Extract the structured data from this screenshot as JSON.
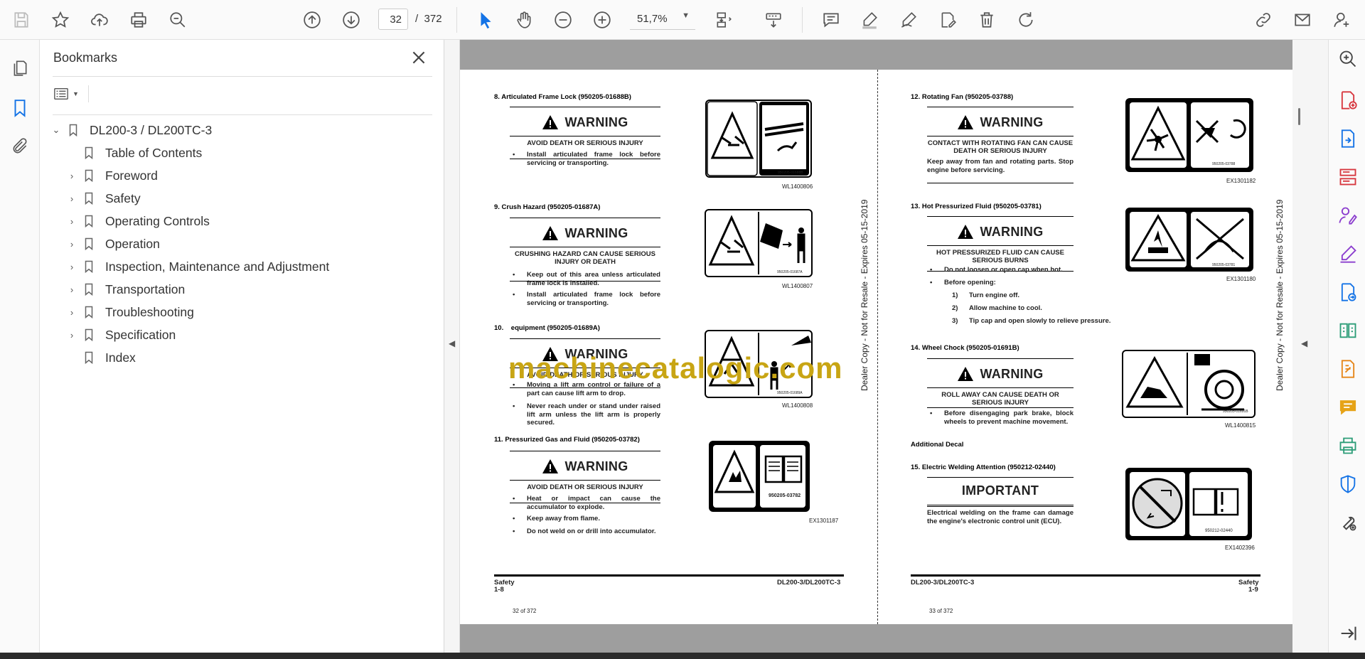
{
  "toolbar": {
    "page_current": "32",
    "page_total": "372",
    "page_sep": "/",
    "zoom": "51,7%"
  },
  "bookmarks": {
    "title": "Bookmarks",
    "items": [
      {
        "label": "DL200-3 / DL200TC-3",
        "level": 0,
        "expanded": true
      },
      {
        "label": "Table of Contents",
        "level": 1
      },
      {
        "label": "Foreword",
        "level": 1,
        "expandable": true
      },
      {
        "label": "Safety",
        "level": 1,
        "expandable": true
      },
      {
        "label": "Operating Controls",
        "level": 1,
        "expandable": true
      },
      {
        "label": "Operation",
        "level": 1,
        "expandable": true
      },
      {
        "label": "Inspection, Maintenance and Adjustment",
        "level": 1,
        "expandable": true
      },
      {
        "label": "Transportation",
        "level": 1,
        "expandable": true
      },
      {
        "label": "Troubleshooting",
        "level": 1,
        "expandable": true
      },
      {
        "label": "Specification",
        "level": 1,
        "expandable": true
      },
      {
        "label": "Index",
        "level": 1
      }
    ]
  },
  "doc": {
    "watermark": "machinecatalogic.com",
    "dealer_note": "Dealer Copy - Not for Resale - Expires 05-15-2019",
    "warning": "WARNING",
    "important": "IMPORTANT",
    "left": {
      "s8": {
        "title": "8.    Articulated Frame Lock (950205-01688B)",
        "avoid": "AVOID DEATH OR SERIOUS INJURY",
        "b1": "Install articulated frame lock before servicing or transporting.",
        "decal": "950205-01688B",
        "ref": "WL1400806"
      },
      "s9": {
        "title": "9.    Crush Hazard (950205-01687A)",
        "avoid": "CRUSHING HAZARD CAN CAUSE SERIOUS INJURY OR DEATH",
        "b1": "Keep out of this area unless articulated frame lock is installed.",
        "b2": "Install articulated frame lock before servicing or transporting.",
        "decal": "950205-01687A",
        "ref": "WL1400807"
      },
      "s10": {
        "title": "10.",
        "title_partial": "equipment (950205-01689A)",
        "avoid": "AVOID DEATH OR SERIOUS INJURY",
        "b1": "Moving a lift arm control or failure of a part can cause lift arm to drop.",
        "b2": "Never reach under or stand under raised lift arm unless the lift arm is properly secured.",
        "decal": "950205-01689A",
        "ref": "WL1400808"
      },
      "s11": {
        "title": "11.    Pressurized Gas and Fluid (950205-03782)",
        "avoid": "AVOID DEATH OR SERIOUS INJURY",
        "b1": "Heat or impact can cause the accumulator to explode.",
        "b2": "Keep away from flame.",
        "b3": "Do not weld on or drill into accumulator.",
        "decal": "950205-03782",
        "ref": "EX1301187"
      },
      "footer_left": "Safety",
      "footer_left2": "1-8",
      "footer_right": "DL200-3/DL200TC-3",
      "pagenum": "32 of 372"
    },
    "right": {
      "s12": {
        "title": "12.    Rotating Fan (950205-03788)",
        "avoid": "CONTACT WITH ROTATING FAN CAN CAUSE DEATH OR SERIOUS INJURY",
        "body": "Keep away from fan and rotating parts. Stop engine before servicing.",
        "decal": "950205-03788",
        "ref": "EX1301182"
      },
      "s13": {
        "title": "13.    Hot Pressurized Fluid (950205-03781)",
        "avoid": "HOT PRESSURIZED FLUID CAN CAUSE SERIOUS BURNS",
        "b1": "Do not loosen or open cap when hot.",
        "b2": "Before opening:",
        "n1": "Turn engine off.",
        "n2": "Allow machine to cool.",
        "n3": "Tip cap and open slowly to relieve pressure.",
        "decal": "950205-03781",
        "ref": "EX1301180"
      },
      "s14": {
        "title": "14.    Wheel Chock (950205-01691B)",
        "avoid": "ROLL AWAY CAN CAUSE DEATH OR SERIOUS INJURY",
        "b1": "Before disengaging park brake, block wheels to prevent machine movement.",
        "decal": "950205-01691B",
        "ref": "WL1400815"
      },
      "additional": "Additional Decal",
      "s15": {
        "title": "15.    Electric Welding Attention (950212-02440)",
        "body": "Electrical welding on the frame can damage the engine's electronic control unit (ECU).",
        "decal": "950212-02440",
        "ref": "EX1402396"
      },
      "footer_left": "DL200-3/DL200TC-3",
      "footer_right": "Safety",
      "footer_right2": "1-9",
      "pagenum": "33 of 372"
    },
    "num_labels": {
      "n1": "1)",
      "n2": "2)",
      "n3": "3)",
      "bullet": "•"
    }
  },
  "colors": {
    "accent": "#1473e6",
    "purple": "#8b3dce",
    "red": "#d7373f",
    "watermark": "#c8a514"
  }
}
